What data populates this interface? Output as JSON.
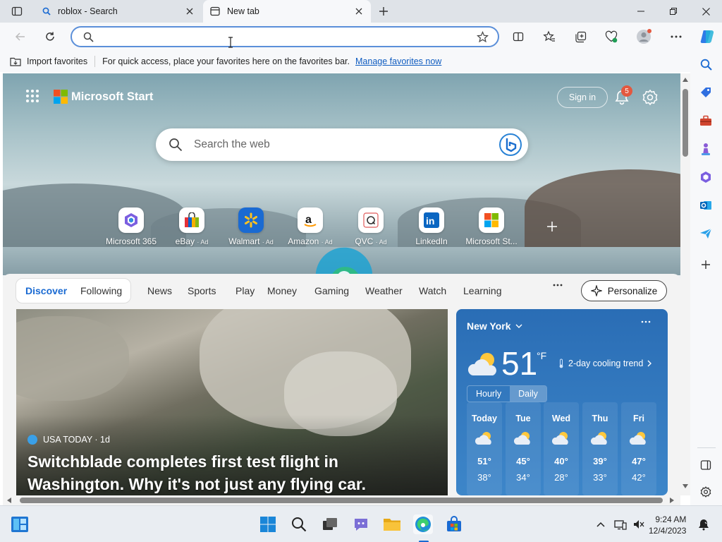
{
  "tabs": [
    {
      "title": "roblox - Search",
      "icon": "search-icon"
    },
    {
      "title": "New tab",
      "icon": "new-tab-icon",
      "active": true
    }
  ],
  "address": {
    "value": "",
    "placeholder": ""
  },
  "favorites_bar": {
    "import_label": "Import favorites",
    "hint": "For quick access, place your favorites here on the favorites bar.",
    "manage_link": "Manage favorites now"
  },
  "header": {
    "brand": "Microsoft Start",
    "sign_in": "Sign in",
    "notification_count": "5"
  },
  "search": {
    "placeholder": "Search the web"
  },
  "quick_links": [
    {
      "label": "Microsoft 365",
      "ad": ""
    },
    {
      "label": "eBay",
      "ad": "· Ad"
    },
    {
      "label": "Walmart",
      "ad": "· Ad"
    },
    {
      "label": "Amazon",
      "ad": "· Ad"
    },
    {
      "label": "QVC",
      "ad": "· Ad"
    },
    {
      "label": "LinkedIn",
      "ad": ""
    },
    {
      "label": "Microsoft St...",
      "ad": ""
    }
  ],
  "feed_nav": [
    "Discover",
    "Following",
    "News",
    "Sports",
    "Play",
    "Money",
    "Gaming",
    "Weather",
    "Watch",
    "Learning"
  ],
  "personalize": "Personalize",
  "story": {
    "source": "USA TODAY · 1d",
    "title": "Switchblade completes first test flight in Washington. Why it's not just any flying car."
  },
  "weather": {
    "location": "New York",
    "temp": "51",
    "unit": "°F",
    "trend": "2-day cooling trend",
    "tabs": [
      "Hourly",
      "Daily"
    ],
    "forecast": [
      {
        "day": "Today",
        "hi": "51°",
        "lo": "38°"
      },
      {
        "day": "Tue",
        "hi": "45°",
        "lo": "34°"
      },
      {
        "day": "Wed",
        "hi": "40°",
        "lo": "28°"
      },
      {
        "day": "Thu",
        "hi": "39°",
        "lo": "33°"
      },
      {
        "day": "Fri",
        "hi": "47°",
        "lo": "42°"
      }
    ]
  },
  "clock": {
    "time": "9:24 AM",
    "date": "12/4/2023"
  },
  "colors": {
    "accent": "#1a6ad2",
    "link": "#0f5cc0",
    "badge": "#e3583f",
    "weather_bg": "#2a6db5"
  }
}
